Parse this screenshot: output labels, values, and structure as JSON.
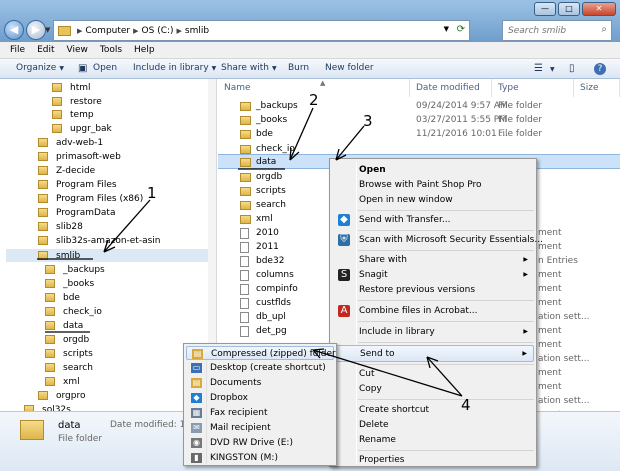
{
  "address": {
    "crumbs": [
      "Computer",
      "OS (C:)",
      "smlib"
    ]
  },
  "search": {
    "placeholder": "Search smlib"
  },
  "menubar": [
    "File",
    "Edit",
    "View",
    "Tools",
    "Help"
  ],
  "toolbar": {
    "organize": "Organize",
    "open": "Open",
    "include": "Include in library",
    "share": "Share with",
    "burn": "Burn",
    "new_folder": "New folder"
  },
  "columns": {
    "name": "Name",
    "date": "Date modified",
    "type": "Type",
    "size": "Size"
  },
  "nav": [
    {
      "label": "html"
    },
    {
      "label": "restore"
    },
    {
      "label": "temp"
    },
    {
      "label": "upgr_bak"
    },
    {
      "label": "adv-web-1"
    },
    {
      "label": "primasoft-web"
    },
    {
      "label": "Z-decide"
    },
    {
      "label": "Program Files"
    },
    {
      "label": "Program Files (x86)"
    },
    {
      "label": "ProgramData"
    },
    {
      "label": "slib28"
    },
    {
      "label": "slib32s-amazon-et-asin"
    },
    {
      "label": "smlib"
    },
    {
      "label": "_backups"
    },
    {
      "label": "_books"
    },
    {
      "label": "bde"
    },
    {
      "label": "check_io"
    },
    {
      "label": "data"
    },
    {
      "label": "orgdb"
    },
    {
      "label": "scripts"
    },
    {
      "label": "search"
    },
    {
      "label": "xml"
    },
    {
      "label": "orgpro"
    },
    {
      "label": "sol32s"
    }
  ],
  "files": [
    {
      "name": "_backups",
      "date": "09/24/2014 9:57 AM",
      "type": "File folder",
      "trunc": ""
    },
    {
      "name": "_books",
      "date": "03/27/2011 5:55 PM",
      "type": "File folder",
      "trunc": ""
    },
    {
      "name": "bde",
      "date": "11/21/2016 10:01 ...",
      "type": "File folder",
      "trunc": ""
    },
    {
      "name": "check_io",
      "date": "",
      "type": "",
      "trunc": ""
    },
    {
      "name": "data",
      "date": "",
      "type": "",
      "trunc": ""
    },
    {
      "name": "orgdb",
      "date": "",
      "type": "",
      "trunc": ""
    },
    {
      "name": "scripts",
      "date": "",
      "type": "",
      "trunc": ""
    },
    {
      "name": "search",
      "date": "",
      "type": "",
      "trunc": ""
    },
    {
      "name": "xml",
      "date": "",
      "type": "",
      "trunc": ""
    },
    {
      "name": "2010",
      "date": "",
      "type": "",
      "trunc": "ment"
    },
    {
      "name": "2011",
      "date": "",
      "type": "",
      "trunc": "ment"
    },
    {
      "name": "bde32",
      "date": "",
      "type": "",
      "trunc": "n Entries"
    },
    {
      "name": "columns",
      "date": "",
      "type": "",
      "trunc": "ment"
    },
    {
      "name": "compinfo",
      "date": "",
      "type": "",
      "trunc": "ment"
    },
    {
      "name": "custflds",
      "date": "",
      "type": "",
      "trunc": "ment"
    },
    {
      "name": "db_upl",
      "date": "",
      "type": "",
      "trunc": "ation sett..."
    },
    {
      "name": "det_pg",
      "date": "",
      "type": "",
      "trunc": "ment"
    },
    {
      "name": "",
      "date": "",
      "type": "",
      "trunc": "ment"
    },
    {
      "name": "",
      "date": "",
      "type": "",
      "trunc": "ation sett..."
    },
    {
      "name": "",
      "date": "",
      "type": "",
      "trunc": "ment"
    },
    {
      "name": "",
      "date": "",
      "type": "",
      "trunc": "ment"
    },
    {
      "name": "",
      "date": "",
      "type": "",
      "trunc": "ation sett..."
    },
    {
      "name": "",
      "date": "",
      "type": "",
      "trunc": "ment"
    }
  ],
  "context_menu": {
    "open": "Open",
    "paintshop": "Browse with Paint Shop Pro",
    "new_window": "Open in new window",
    "transfer": "Send with Transfer...",
    "security": "Scan with Microsoft Security Essentials...",
    "share": "Share with",
    "snagit": "Snagit",
    "restore": "Restore previous versions",
    "acrobat": "Combine files in Acrobat...",
    "library": "Include in library",
    "send_to": "Send to",
    "cut": "Cut",
    "copy": "Copy",
    "shortcut": "Create shortcut",
    "delete": "Delete",
    "rename": "Rename",
    "properties": "Properties"
  },
  "send_to": [
    {
      "label": "Compressed (zipped) folder",
      "icon": "zip-folder-icon",
      "color": "#d9a93a"
    },
    {
      "label": "Desktop (create shortcut)",
      "icon": "desktop-icon",
      "color": "#3b6fb6"
    },
    {
      "label": "Documents",
      "icon": "documents-icon",
      "color": "#d9a93a"
    },
    {
      "label": "Dropbox",
      "icon": "dropbox-icon",
      "color": "#1f7fd4"
    },
    {
      "label": "Fax recipient",
      "icon": "fax-icon",
      "color": "#6a7d92"
    },
    {
      "label": "Mail recipient",
      "icon": "mail-icon",
      "color": "#8a9bb0"
    },
    {
      "label": "DVD RW Drive (E:)",
      "icon": "dvd-drive-icon",
      "color": "#777777"
    },
    {
      "label": "KINGSTON (M:)",
      "icon": "usb-drive-icon",
      "color": "#6a6a6a"
    }
  ],
  "details": {
    "name": "data",
    "label": "Date modified: 11/21/20",
    "type": "File folder"
  },
  "callouts": [
    "1",
    "2",
    "3",
    "4"
  ]
}
